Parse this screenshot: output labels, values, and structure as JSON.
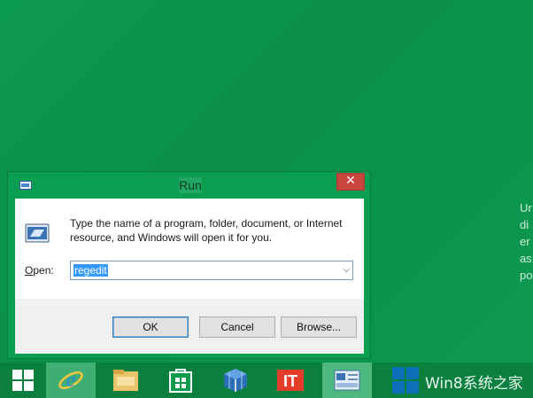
{
  "window": {
    "title": "Run",
    "close_label": "✕",
    "description": "Type the name of a program, folder, document, or Internet resource, and Windows will open it for you.",
    "open_label_prefix": "",
    "open_label_underline": "O",
    "open_label_rest": "pen:",
    "open_value": "regedit",
    "buttons": {
      "ok": "OK",
      "cancel": "Cancel",
      "browse": "Browse..."
    }
  },
  "desktop": {
    "side_text": [
      "Ur",
      "di",
      "er",
      "as",
      "po"
    ]
  },
  "taskbar": {
    "items": [
      {
        "name": "start-icon"
      },
      {
        "name": "internet-explorer-icon"
      },
      {
        "name": "file-explorer-icon"
      },
      {
        "name": "store-icon"
      },
      {
        "name": "app-cube-icon"
      },
      {
        "name": "it-app-icon"
      },
      {
        "name": "run-dialog-icon"
      }
    ],
    "brand_text": "Win8系统之家"
  },
  "colors": {
    "desktop": "#0c9a4f",
    "taskbar": "#0a7f3e",
    "close": "#c7453d",
    "selection": "#3399ff"
  }
}
